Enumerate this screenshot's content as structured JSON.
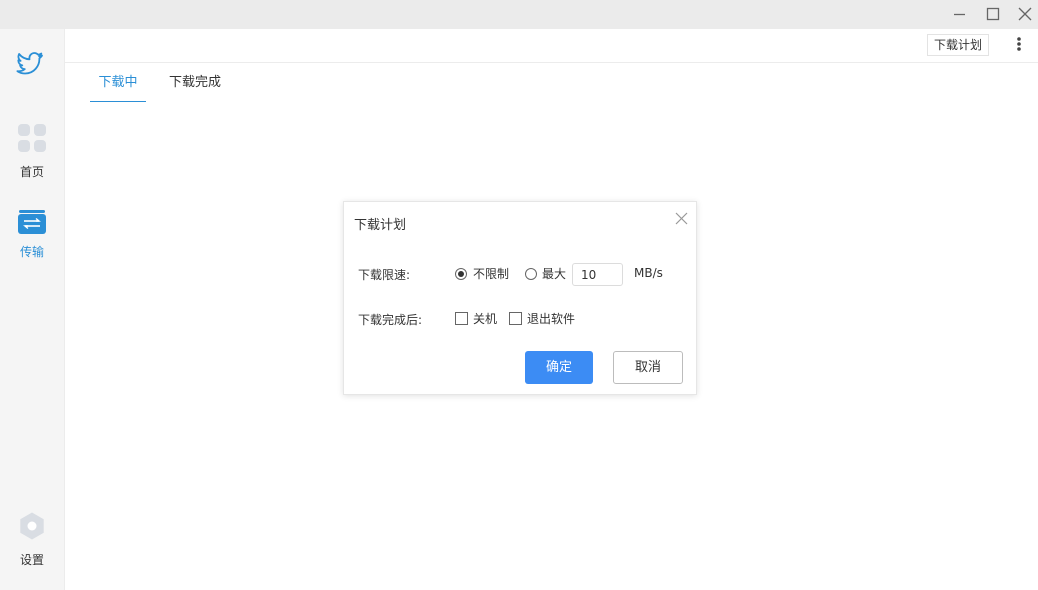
{
  "window": {
    "minimize_icon": "minimize-icon",
    "maximize_icon": "maximize-icon",
    "close_icon": "close-icon"
  },
  "sidebar": {
    "logo_icon": "bird-logo-icon",
    "items": [
      {
        "label": "首页",
        "icon": "grid-icon",
        "active": false
      },
      {
        "label": "传输",
        "icon": "transfer-icon",
        "active": true
      }
    ],
    "settings": {
      "label": "设置",
      "icon": "gear-icon"
    }
  },
  "toolbar": {
    "plan_button": "下载计划",
    "more_icon": "more-vertical-icon"
  },
  "tabs": [
    {
      "label": "下载中",
      "active": true
    },
    {
      "label": "下载完成",
      "active": false
    }
  ],
  "dialog": {
    "title": "下载计划",
    "speed_label": "下载限速:",
    "option_unlimited": "不限制",
    "option_max": "最大",
    "speed_value": "10",
    "unit": "MB/s",
    "selected_speed": "不限制",
    "after_label": "下载完成后:",
    "check_shutdown": "关机",
    "check_exit": "退出软件",
    "shutdown_checked": false,
    "exit_checked": false,
    "ok": "确定",
    "cancel": "取消"
  },
  "colors": {
    "accent": "#2b8fd6",
    "primary_button": "#3c8cf4"
  }
}
